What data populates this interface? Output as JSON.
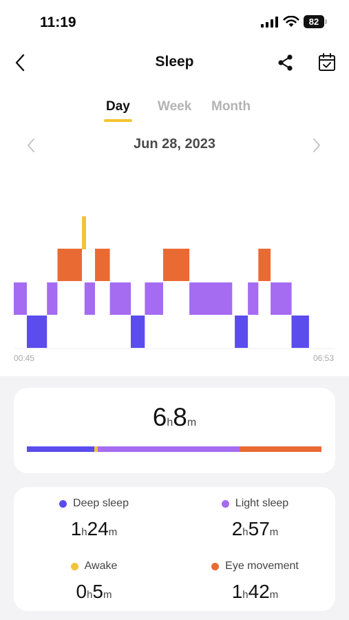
{
  "status_bar": {
    "time": "11:19",
    "battery": "82"
  },
  "header": {
    "title": "Sleep"
  },
  "tabs": [
    "Day",
    "Week",
    "Month"
  ],
  "date": "Jun 28, 2023",
  "colors": {
    "deep": "#5b4cee",
    "light": "#a56cf2",
    "awake": "#f3c23c",
    "rem": "#ea6a33",
    "accent": "#f4c430"
  },
  "chart_data": {
    "type": "sleep-stages",
    "x_start": "00:45",
    "x_end": "06:53",
    "stage_levels": [
      "awake",
      "rem",
      "light",
      "deep"
    ],
    "segments": [
      {
        "stage": "light",
        "start_min": 0,
        "end_min": 15
      },
      {
        "stage": "deep",
        "start_min": 15,
        "end_min": 38
      },
      {
        "stage": "light",
        "start_min": 38,
        "end_min": 50
      },
      {
        "stage": "rem",
        "start_min": 50,
        "end_min": 78
      },
      {
        "stage": "awake",
        "start_min": 78,
        "end_min": 81
      },
      {
        "stage": "light",
        "start_min": 81,
        "end_min": 93
      },
      {
        "stage": "rem",
        "start_min": 93,
        "end_min": 110
      },
      {
        "stage": "light",
        "start_min": 110,
        "end_min": 134
      },
      {
        "stage": "deep",
        "start_min": 134,
        "end_min": 150
      },
      {
        "stage": "light",
        "start_min": 150,
        "end_min": 171
      },
      {
        "stage": "rem",
        "start_min": 171,
        "end_min": 201
      },
      {
        "stage": "light",
        "start_min": 201,
        "end_min": 234
      },
      {
        "stage": "deep",
        "start_min": 253,
        "end_min": 268
      },
      {
        "stage": "light",
        "start_min": 268,
        "end_min": 280
      },
      {
        "stage": "rem",
        "start_min": 280,
        "end_min": 294
      },
      {
        "stage": "light",
        "start_min": 294,
        "end_min": 318
      },
      {
        "stage": "deep",
        "start_min": 318,
        "end_min": 338
      },
      {
        "stage": "light",
        "start_min": 234,
        "end_min": 250
      }
    ],
    "total_min": 368
  },
  "summary": {
    "hours": "6",
    "hours_unit": "h",
    "minutes": "8",
    "minutes_unit": "m",
    "bar": [
      {
        "stage": "deep",
        "fraction": 0.228
      },
      {
        "stage": "awake",
        "fraction": 0.013
      },
      {
        "stage": "light",
        "fraction": 0.482
      },
      {
        "stage": "rem",
        "fraction": 0.277
      }
    ]
  },
  "stats": [
    {
      "label": "Deep sleep",
      "stage": "deep",
      "h": "1",
      "m": "24",
      "hu": "h",
      "mu": "m"
    },
    {
      "label": "Light sleep",
      "stage": "light",
      "h": "2",
      "m": "57",
      "hu": "h",
      "mu": "m"
    },
    {
      "label": "Awake",
      "stage": "awake",
      "h": "0",
      "m": "5",
      "hu": "h",
      "mu": "m"
    },
    {
      "label": "Eye movement",
      "stage": "rem",
      "h": "1",
      "m": "42",
      "hu": "h",
      "mu": "m"
    }
  ]
}
